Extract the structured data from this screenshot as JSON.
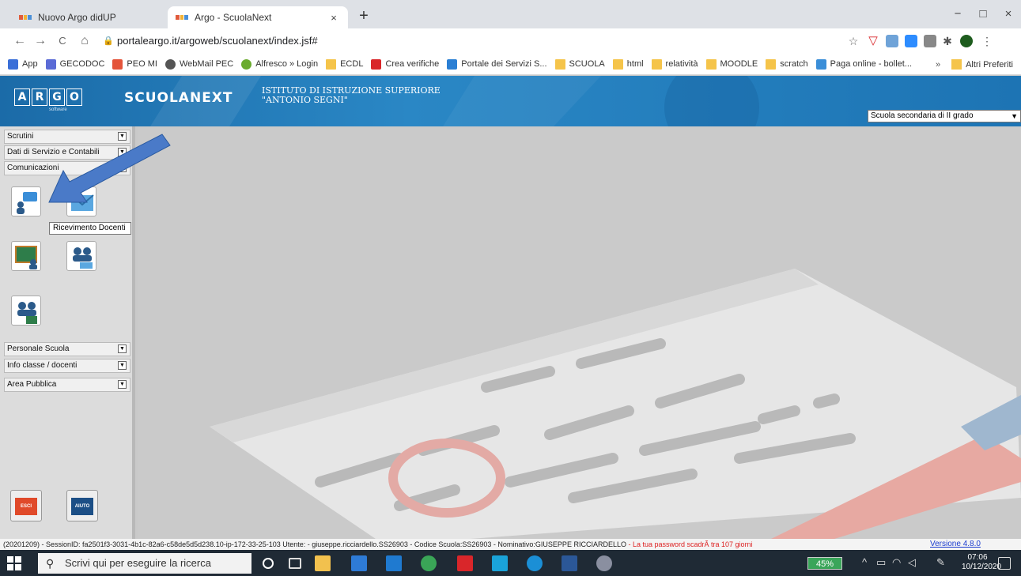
{
  "browser": {
    "tabs": [
      {
        "label": "Nuovo Argo didUP",
        "close": "×",
        "active": false
      },
      {
        "label": "Argo - ScuolaNext",
        "close": "×",
        "active": true
      }
    ],
    "new_tab": "+",
    "window_controls": {
      "minimize": "−",
      "maximize": "□",
      "close": "×"
    },
    "nav": {
      "back": "←",
      "forward": "→",
      "reload": "C",
      "home": "⌂"
    },
    "url": "portaleargo.it/argoweb/scuolanext/index.jsf#",
    "bookmarks": [
      {
        "label": "App",
        "icon": "apps-grid-icon",
        "color": "#3a6fd8"
      },
      {
        "label": "GECODOC",
        "icon": "gecodoc-icon",
        "color": "#5b6bd6"
      },
      {
        "label": "PEO MI",
        "icon": "peo-icon",
        "color": "#e4543a"
      },
      {
        "label": "WebMail PEC",
        "icon": "webmail-icon",
        "color": "#555555"
      },
      {
        "label": "Alfresco » Login",
        "icon": "alfresco-icon",
        "color": "#6aab2e"
      },
      {
        "label": "ECDL",
        "icon": "folder-icon",
        "color": "#f5c44a"
      },
      {
        "label": "Crea verifiche",
        "icon": "crea-verifiche-icon",
        "color": "#d9262a"
      },
      {
        "label": "Portale dei Servizi S...",
        "icon": "portale-icon",
        "color": "#2a7fd4"
      },
      {
        "label": "SCUOLA",
        "icon": "folder-icon",
        "color": "#f5c44a"
      },
      {
        "label": "html",
        "icon": "folder-icon",
        "color": "#f5c44a"
      },
      {
        "label": "relatività",
        "icon": "folder-icon",
        "color": "#f5c44a"
      },
      {
        "label": "MOODLE",
        "icon": "folder-icon",
        "color": "#f5c44a"
      },
      {
        "label": "scratch",
        "icon": "folder-icon",
        "color": "#f5c44a"
      },
      {
        "label": "Paga online - bollet...",
        "icon": "paga-online-icon",
        "color": "#3a8ed8"
      }
    ],
    "bookmarks_more": "»",
    "other_bookmarks": "Altri Preferiti"
  },
  "header": {
    "logo_letters": [
      "A",
      "R",
      "G",
      "O"
    ],
    "logo_sub": "software",
    "app_name": "SCUOLANEXT",
    "school_line1": "ISTITUTO DI ISTRUZIONE SUPERIORE",
    "school_line2": "\"ANTONIO SEGNI\"",
    "school_type_selected": "Scuola secondaria di II grado"
  },
  "sidebar": {
    "top_menu": [
      {
        "label": "Scrutini"
      },
      {
        "label": "Dati di Servizio e Contabili"
      },
      {
        "label": "Comunicazioni"
      }
    ],
    "bottom_menu": [
      {
        "label": "Personale Scuola"
      },
      {
        "label": "Info classe / docenti"
      },
      {
        "label": "Area Pubblica"
      }
    ],
    "tooltip": "Ricevimento Docenti",
    "exit_button": "ESCI",
    "help_button": "AIUTO"
  },
  "status": {
    "session": "(20201209) - SessionID: fa2501f3-3031-4b1c-82a6-c58de5d5d238.10-ip-172-33-25-103 Utente: - giuseppe.ricciardello.SS26903 - Codice Scuola:SS26903 - Nominativo:GIUSEPPE RICCIARDELLO",
    "warning": "- La tua password scadrÃ  tra 107 giorni",
    "version": "Versione 4.8.0"
  },
  "taskbar": {
    "search_placeholder": "Scrivi qui per eseguire la ricerca",
    "battery": "45%",
    "time": "07:06",
    "date": "10/12/2020"
  },
  "colors": {
    "header_blue": "#1b6ba8",
    "arrow_blue": "#4a7ac8",
    "exit_red": "#e04a2a",
    "help_blue": "#1c4f86"
  }
}
